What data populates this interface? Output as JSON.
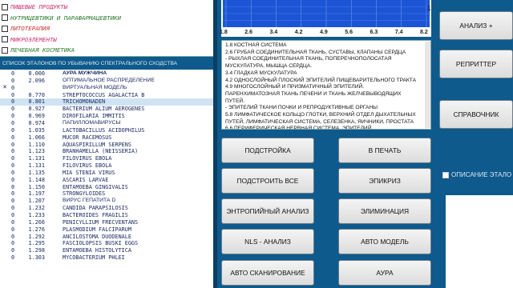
{
  "categories": [
    {
      "label": "ПИЩЕВЫЕ  ПРОДУКТЫ",
      "color": "#cc3377"
    },
    {
      "label": "НУТРИЦЕВТИКИ И ПАРАФАРМАЦЕВТИКИ",
      "color": "#2a7a2a"
    },
    {
      "label": "ЛИТОТЕРАПИЯ",
      "color": "#cc3333"
    },
    {
      "label": "МИКРОЭЛЕМЕНТЫ",
      "color": "#cc3377"
    },
    {
      "label": "ЛЕЧЕБНАЯ КОСМЕТИКА",
      "color": "#2a7a2a"
    }
  ],
  "list_title": "СПИСОК ЭТАЛОНОВ ПО УБЫВАНИЮ СПЕКТРАЛЬНОГО СХОДСТВА",
  "rows": [
    {
      "mark": "",
      "num": "0",
      "value": "0.000",
      "name": "АУРА МУЖЧИНА"
    },
    {
      "mark": "",
      "num": "0",
      "value": "2.096",
      "name": "ОПТИМАЛЬНОЕ РАСПРЕДЕЛЕНИЕ"
    },
    {
      "mark": "✕",
      "num": "0",
      "value": "",
      "name": "ВИРТУАЛЬНАЯ МОДЕЛЬ"
    },
    {
      "mark": "",
      "num": "0",
      "value": "0.770",
      "name": "STREPTOCOCCUS AGALACTIA B"
    },
    {
      "mark": "",
      "num": "0",
      "value": "0.801",
      "name": "TRICHOMONADEN"
    },
    {
      "mark": "",
      "num": "0",
      "value": "0.927",
      "name": "BACTERIUM ALIUM AEROGENES"
    },
    {
      "mark": "",
      "num": "0",
      "value": "0.969",
      "name": "DIROFILARIA IMMITIS"
    },
    {
      "mark": "",
      "num": "0",
      "value": "0.974",
      "name": "ПАПИЛЛОМАВИРУСЫ"
    },
    {
      "mark": "",
      "num": "0",
      "value": "1.035",
      "name": "LACTOBACILLUS ACIDOPHILUS"
    },
    {
      "mark": "",
      "num": "0",
      "value": "1.066",
      "name": "MUCOR RACEMOSUS"
    },
    {
      "mark": "",
      "num": "0",
      "value": "1.110",
      "name": "AQUASPIRILLUM SERPENS"
    },
    {
      "mark": "",
      "num": "0",
      "value": "1.123",
      "name": "BRANHAMELLA (NEISSERIA)"
    },
    {
      "mark": "",
      "num": "0",
      "value": "1.131",
      "name": "FILOVIRUS  EBOLA"
    },
    {
      "mark": "",
      "num": "0",
      "value": "1.131",
      "name": "FILOVIRUS  EBOLA"
    },
    {
      "mark": "",
      "num": "0",
      "value": "1.135",
      "name": "MIA STENIA VIRUS"
    },
    {
      "mark": "",
      "num": "0",
      "value": "1.148",
      "name": "ASCARIS LARVAE"
    },
    {
      "mark": "",
      "num": "0",
      "value": "1.150",
      "name": "ENTAMOEBA GINGIVALIS"
    },
    {
      "mark": "",
      "num": "0",
      "value": "1.197",
      "name": "STRONGYLOIDES"
    },
    {
      "mark": "",
      "num": "0",
      "value": "1.207",
      "name": "ВИРУС ГЕПАТИТА D"
    },
    {
      "mark": "",
      "num": "0",
      "value": "1.232",
      "name": "CANDIDA PARAPSILOSIS"
    },
    {
      "mark": "",
      "num": "0",
      "value": "1.233",
      "name": "BACTEROIDES FRAGILIS"
    },
    {
      "mark": "",
      "num": "0",
      "value": "1.266",
      "name": "PENICYLLIUM FRECVENTANS"
    },
    {
      "mark": "",
      "num": "0",
      "value": "1.276",
      "name": "PLASMODIUM FALCIPARUM"
    },
    {
      "mark": "",
      "num": "0",
      "value": "1.292",
      "name": "ANCILOSTOMA DUODENALE"
    },
    {
      "mark": "",
      "num": "0",
      "value": "1.295",
      "name": "FASCIOLOPSIS BUSKI EGGS"
    },
    {
      "mark": "",
      "num": "0",
      "value": "1.298",
      "name": "ENTAMOEBA HISTOLYTICA"
    },
    {
      "mark": "",
      "num": "0",
      "value": "1.303",
      "name": "MYCOBACTERIUM PHLEI"
    }
  ],
  "chart": {
    "ticks": [
      "1.8",
      "2.6",
      "3.4",
      "4.2",
      "4.9",
      "5.6",
      "6.3",
      "7.4",
      "8.2"
    ],
    "y_label": "1",
    "area_color": "#1b55d6"
  },
  "info_lines": [
    "1.8 КОСТНАЯ СИСТЕМА",
    "2.6 ГРУБАЯ СОЕДИНИТЕЛЬНАЯ ТКАНЬ, СУСТАВЫ, КЛАПАНЫ СЕРДЦА",
    "- РЫХЛАЯ СОЕДИНИТЕЛЬНАЯ ТКАНЬ, ПОПЕРЕЧНОПОЛОСАТАЯ",
    "МУСКУЛАТУРА, МЫШЦА СЕРДЦА.",
    "3.4 ГЛАДКАЯ МУСКУЛАТУРА",
    "4.2 ОДНОСЛОЙНЫЙ ПЛОСКИЙ ЭПИТЕЛИЙ ПИЩЕВАРИТЕЛЬНОГО ТРАКТА",
    "4.9 МНОГОСЛОЙНЫЙ И ПРИЗМАТИЧНЫЙ ЭПИТЕЛИЙ.",
    "ПАРЕНХИМАТОЗНАЯ ТКАНЬ ПЕЧЕНИ И ТКАНЬ ЖЕЛЧЕВЫВОДЯЩИХ",
    "ПУТЕЙ.",
    "- ЭПИТЕЛИЙ ТКАНИ ПОЧКИ И РЕПРОДУКТИВНЫЕ ОРГАНЫ",
    "5.8 ЛИМФАТИЧЕСКОЕ КОЛЬЦО ГЛОТКИ, ВЕРХНИЙ ОТДЕЛ ДЫХАТЕЛЬНЫХ",
    "ПУТЕЙ, ЛИМФАТИЧЕСКАЯ СИСТЕМА, СЕЛЕЗЕНКА, ЯИЧНИКИ, ПРОСТАТА",
    "6.6 ПЕРИФЕРИЧЕСКАЯ НЕРВНАЯ СИСТЕМА, ЭПИТЕЛИЙ"
  ],
  "buttons": {
    "build": "ПОДСТРОЙКА",
    "print": "В ПЕЧАТЬ",
    "build_all": "ПОДСТРОИТЬ ВСЕ",
    "epicrisis": "ЭПИКРИЗ",
    "entropy": "ЭНТРОПИЙНЫЙ АНАЛИЗ",
    "elimination": "ЭЛИМИНАЦИЯ",
    "nls": "NLS - АНАЛИЗ",
    "auto_model": "АВТО МОДЕЛЬ",
    "auto_scan": "АВТО СКАНИРОВАНИЕ",
    "aura": "АУРА"
  },
  "right": {
    "analysis": "АНАЛИЗ  +",
    "repeater": "РЕПРИТТЕР",
    "reference": "СПРАВОЧНИК",
    "description_label": "ОПИСАНИЕ ЭТАЛО"
  }
}
